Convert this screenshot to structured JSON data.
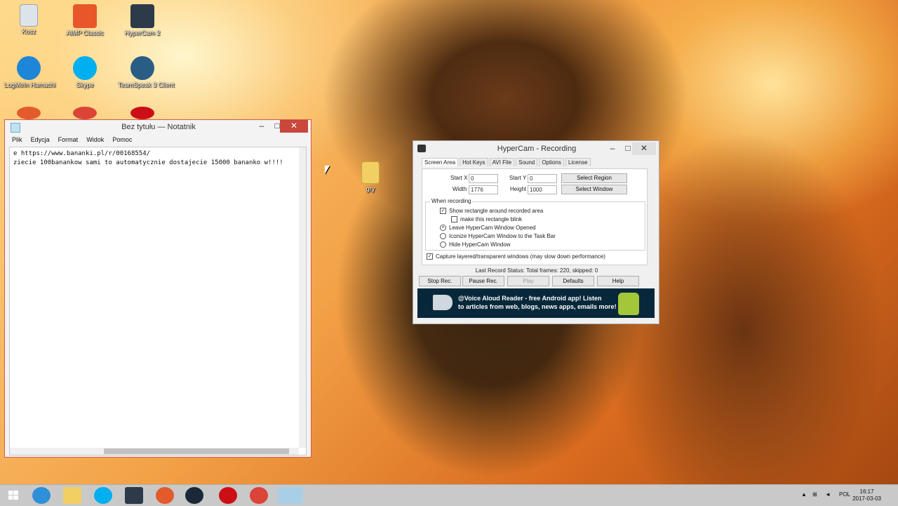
{
  "desktop": {
    "icons": [
      {
        "label": "Kosz"
      },
      {
        "label": "AIMP Classic"
      },
      {
        "label": "HyperCam 2"
      },
      {
        "label": "LogMeIn Hamachi"
      },
      {
        "label": "Skype"
      },
      {
        "label": "TeamSpeak 3 Client"
      },
      {
        "label": "gry"
      }
    ]
  },
  "notepad": {
    "title": "Bez tytułu — Notatnik",
    "menu": [
      "Plik",
      "Edycja",
      "Format",
      "Widok",
      "Pomoc"
    ],
    "content": "e https://www.bananki.pl/r/00168554/\nziecie 100banankow sami to automatycznie dostajecie 15000 bananko w!!!!",
    "min_icon": "minimize-icon",
    "max_icon": "maximize-icon",
    "close_icon": "close-icon"
  },
  "hypercam": {
    "title": "HyperCam - Recording",
    "tabs": [
      "Screen Area",
      "Hot Keys",
      "AVI File",
      "Sound",
      "Options",
      "License"
    ],
    "start_x_label": "Start X",
    "start_x_value": "0",
    "start_y_label": "Start Y",
    "start_y_value": "0",
    "width_label": "Width",
    "width_value": "1776",
    "height_label": "Height",
    "height_value": "1000",
    "select_region": "Select Region",
    "select_window": "Select Window",
    "group_title": "When recording",
    "options": {
      "show_rect": "Show rectangle around recorded area",
      "blink": "make this rectangle blink",
      "leave_open": "Leave HyperCam Window Opened",
      "iconize": "Iconize HyperCam Window to the Task Bar",
      "hide": "Hide HyperCam Window",
      "capture_layered": "Capture layered/transparent windows (may slow down performance)"
    },
    "status": "Last Record Status: Total frames: 220, skipped: 0",
    "buttons": {
      "stop": "Stop Rec.",
      "pause": "Pause Rec.",
      "play": "Play",
      "defaults": "Defaults",
      "help": "Help"
    },
    "banner": {
      "line1": "@Voice Aloud Reader - free Android app! Listen",
      "line2": "to articles from web, blogs, news apps, emails more!"
    }
  },
  "taskbar": {
    "lang": "POL",
    "time": "16:17",
    "date": "2017-03-03"
  }
}
